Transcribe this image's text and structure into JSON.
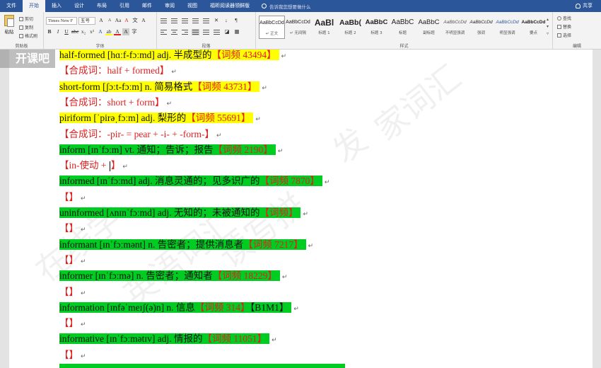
{
  "tabs": [
    "文件",
    "开始",
    "插入",
    "设计",
    "布局",
    "引用",
    "邮件",
    "审阅",
    "视图",
    "福昕阅读器领鲜版"
  ],
  "active_tab_index": 1,
  "tell_me": "告诉我您想要做什么",
  "share": "共享",
  "clipboard": {
    "paste": "粘贴",
    "cut": "剪切",
    "copy": "复制",
    "format_painter": "格式刷",
    "label": "剪贴板"
  },
  "font": {
    "name": "Times New F",
    "size": "五号",
    "label": "字体"
  },
  "paragraph": {
    "label": "段落"
  },
  "styles": {
    "label": "样式",
    "items": [
      {
        "sample": "AaBbCcDd",
        "name": "↵ 正文"
      },
      {
        "sample": "AaBbCcDd",
        "name": "↵ 无间隔"
      },
      {
        "sample": "AaBl",
        "name": "标题 1"
      },
      {
        "sample": "AaBb(",
        "name": "标题 2"
      },
      {
        "sample": "AaBbC",
        "name": "标题 3"
      },
      {
        "sample": "AaBbC",
        "name": "标题"
      },
      {
        "sample": "AaBbC",
        "name": "副标题"
      },
      {
        "sample": "AaBbCcDd",
        "name": "不明显强调"
      },
      {
        "sample": "AaBbCcDd",
        "name": "强调"
      },
      {
        "sample": "AaBbCcDd",
        "name": "明显强调"
      },
      {
        "sample": "AaBbCcDd",
        "name": "要点"
      }
    ]
  },
  "editing": {
    "find": "查找",
    "replace": "替换",
    "select": "选择",
    "label": "编辑"
  },
  "logo": "开课吧",
  "watermarks": [
    "在线学",
    "英语词汇",
    "读写拼",
    "发",
    "家词汇"
  ],
  "document": {
    "lines": [
      {
        "pre": "half-formed [hɑːf-fɔːmd] adj.  半成型的",
        "red": "【词频 43494】",
        "post": "",
        "hl": "y"
      },
      {
        "pre": "",
        "red": "【合成词：half + formed】",
        "post": "",
        "hl": ""
      },
      {
        "pre": "short-form [ʃɔːt-fɔːm] n.  简易格式",
        "red": "【词频 43731】",
        "post": "",
        "hl": "y"
      },
      {
        "pre": "",
        "red": "【合成词：short + form】",
        "post": "",
        "hl": ""
      },
      {
        "pre": "piriform [ˈpirəˌfɔːm] adj.  梨形的",
        "red": "【词频 55691】",
        "post": "",
        "hl": "y"
      },
      {
        "pre": "",
        "red": "【合成词：-pir- = pear + -i- + -form-】",
        "post": "",
        "hl": ""
      },
      {
        "pre": "inform [ɪnˈfɔːm] vt.  通知；告诉；报告",
        "red": "【词频 2190】",
        "post": "",
        "hl": "g"
      },
      {
        "pre": "",
        "red": "【in-使动 + ",
        "post": "】",
        "hl": "",
        "caret": true
      },
      {
        "pre": "informed [ɪnˈfɔːmd] adj.  消息灵通的；见多识广的",
        "red": "【词频 7870】",
        "post": "",
        "hl": "g"
      },
      {
        "pre": "",
        "red": "【】",
        "post": "",
        "hl": ""
      },
      {
        "pre": "uninformed [ʌnɪnˈfɔːmd] adj.  无知的；未被通知的",
        "red": "【词频】",
        "post": "",
        "hl": "g"
      },
      {
        "pre": "",
        "red": "【】",
        "post": "",
        "hl": ""
      },
      {
        "pre": "informant [ɪnˈfɔːmənt] n.  告密者；提供消息者",
        "red": "【词频 7217】",
        "post": "",
        "hl": "g"
      },
      {
        "pre": "",
        "red": "【】",
        "post": "",
        "hl": ""
      },
      {
        "pre": "informer [ɪnˈfɔːmə] n.  告密者；通知者",
        "red": "【词频 18229】",
        "post": "",
        "hl": "g"
      },
      {
        "pre": "",
        "red": "【】",
        "post": "",
        "hl": ""
      },
      {
        "pre": "information [ɪnfəˈmeɪʃ(ə)n] n.  信息",
        "red": "【词频 314】",
        "post": "【B1M1】",
        "hl": "g"
      },
      {
        "pre": "",
        "red": "【】",
        "post": "",
        "hl": ""
      },
      {
        "pre": "informative [ɪnˈfɔːmətɪv] adj.  情报的",
        "red": "【词频 11051】",
        "post": "",
        "hl": "g"
      },
      {
        "pre": "",
        "red": "【】",
        "post": "",
        "hl": ""
      }
    ]
  }
}
